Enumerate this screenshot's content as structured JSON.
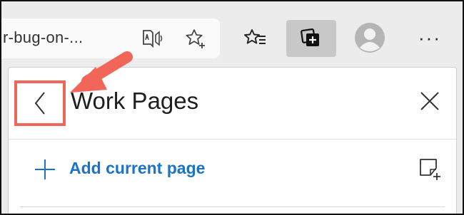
{
  "toolbar": {
    "url_text": "r-bug-on-...",
    "icons": [
      "read-aloud-icon",
      "add-favorite-icon",
      "favorites-icon",
      "collections-icon",
      "profile-avatar",
      "more-icon"
    ],
    "more_label": "···"
  },
  "panel": {
    "title": "Work Pages",
    "add_label": "Add current page"
  },
  "annotation": {
    "color": "#f2665a"
  }
}
